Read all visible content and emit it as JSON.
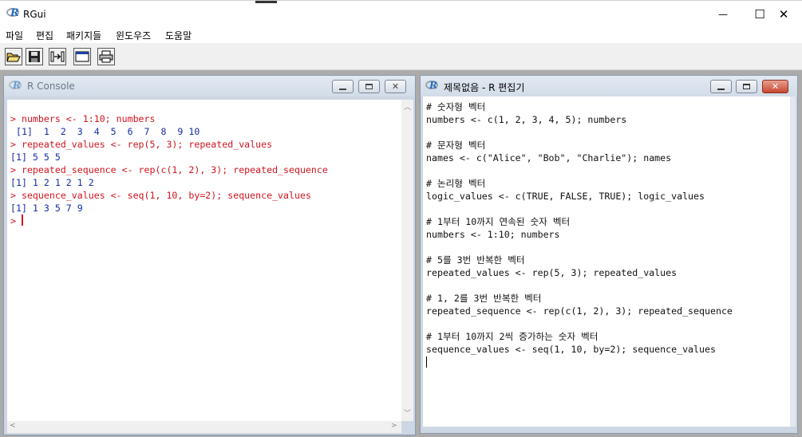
{
  "app": {
    "title": "RGui",
    "logo_letter": "R",
    "window_controls": {
      "minimize": "—",
      "maximize": "☐",
      "close": "✕"
    }
  },
  "menu": {
    "items": [
      "파일",
      "편집",
      "패키지들",
      "윈도우즈",
      "도움말"
    ]
  },
  "toolbar": {
    "buttons": [
      "open-script",
      "save",
      "load-workspace",
      "console-window",
      "print"
    ]
  },
  "console": {
    "title": "R Console",
    "lines": [
      {
        "prompt": "> ",
        "text": "numbers <- 1:10; numbers",
        "kind": "input"
      },
      {
        "prompt": "",
        "text": " [1]  1  2  3  4  5  6  7  8  9 10",
        "kind": "output"
      },
      {
        "prompt": "> ",
        "text": "repeated_values <- rep(5, 3); repeated_values",
        "kind": "input"
      },
      {
        "prompt": "",
        "text": "[1] 5 5 5",
        "kind": "output"
      },
      {
        "prompt": "> ",
        "text": "repeated_sequence <- rep(c(1, 2), 3); repeated_sequence",
        "kind": "input"
      },
      {
        "prompt": "",
        "text": "[1] 1 2 1 2 1 2",
        "kind": "output"
      },
      {
        "prompt": "> ",
        "text": "sequence_values <- seq(1, 10, by=2); sequence_values",
        "kind": "input"
      },
      {
        "prompt": "",
        "text": "[1] 1 3 5 7 9",
        "kind": "output"
      },
      {
        "prompt": "> ",
        "text": "",
        "kind": "current"
      }
    ]
  },
  "editor": {
    "title": "제목없음 - R 편집기",
    "lines": [
      "# 숫자형 벡터",
      "numbers <- c(1, 2, 3, 4, 5); numbers",
      "",
      "# 문자형 벡터",
      "names <- c(\"Alice\", \"Bob\", \"Charlie\"); names",
      "",
      "# 논리형 벡터",
      "logic_values <- c(TRUE, FALSE, TRUE); logic_values",
      "",
      "# 1부터 10까지 연속된 숫자 벡터",
      "numbers <- 1:10; numbers",
      "",
      "# 5를 3번 반복한 벡터",
      "repeated_values <- rep(5, 3); repeated_values",
      "",
      "# 1, 2를 3번 반복한 벡터",
      "repeated_sequence <- rep(c(1, 2), 3); repeated_sequence",
      "",
      "# 1부터 10까지 2씩 증가하는 숫자 벡터",
      "sequence_values <- seq(1, 10, by=2); sequence_values"
    ]
  },
  "colors": {
    "input": "#d2141e",
    "output": "#142ea4",
    "editor_text": "#111111"
  }
}
